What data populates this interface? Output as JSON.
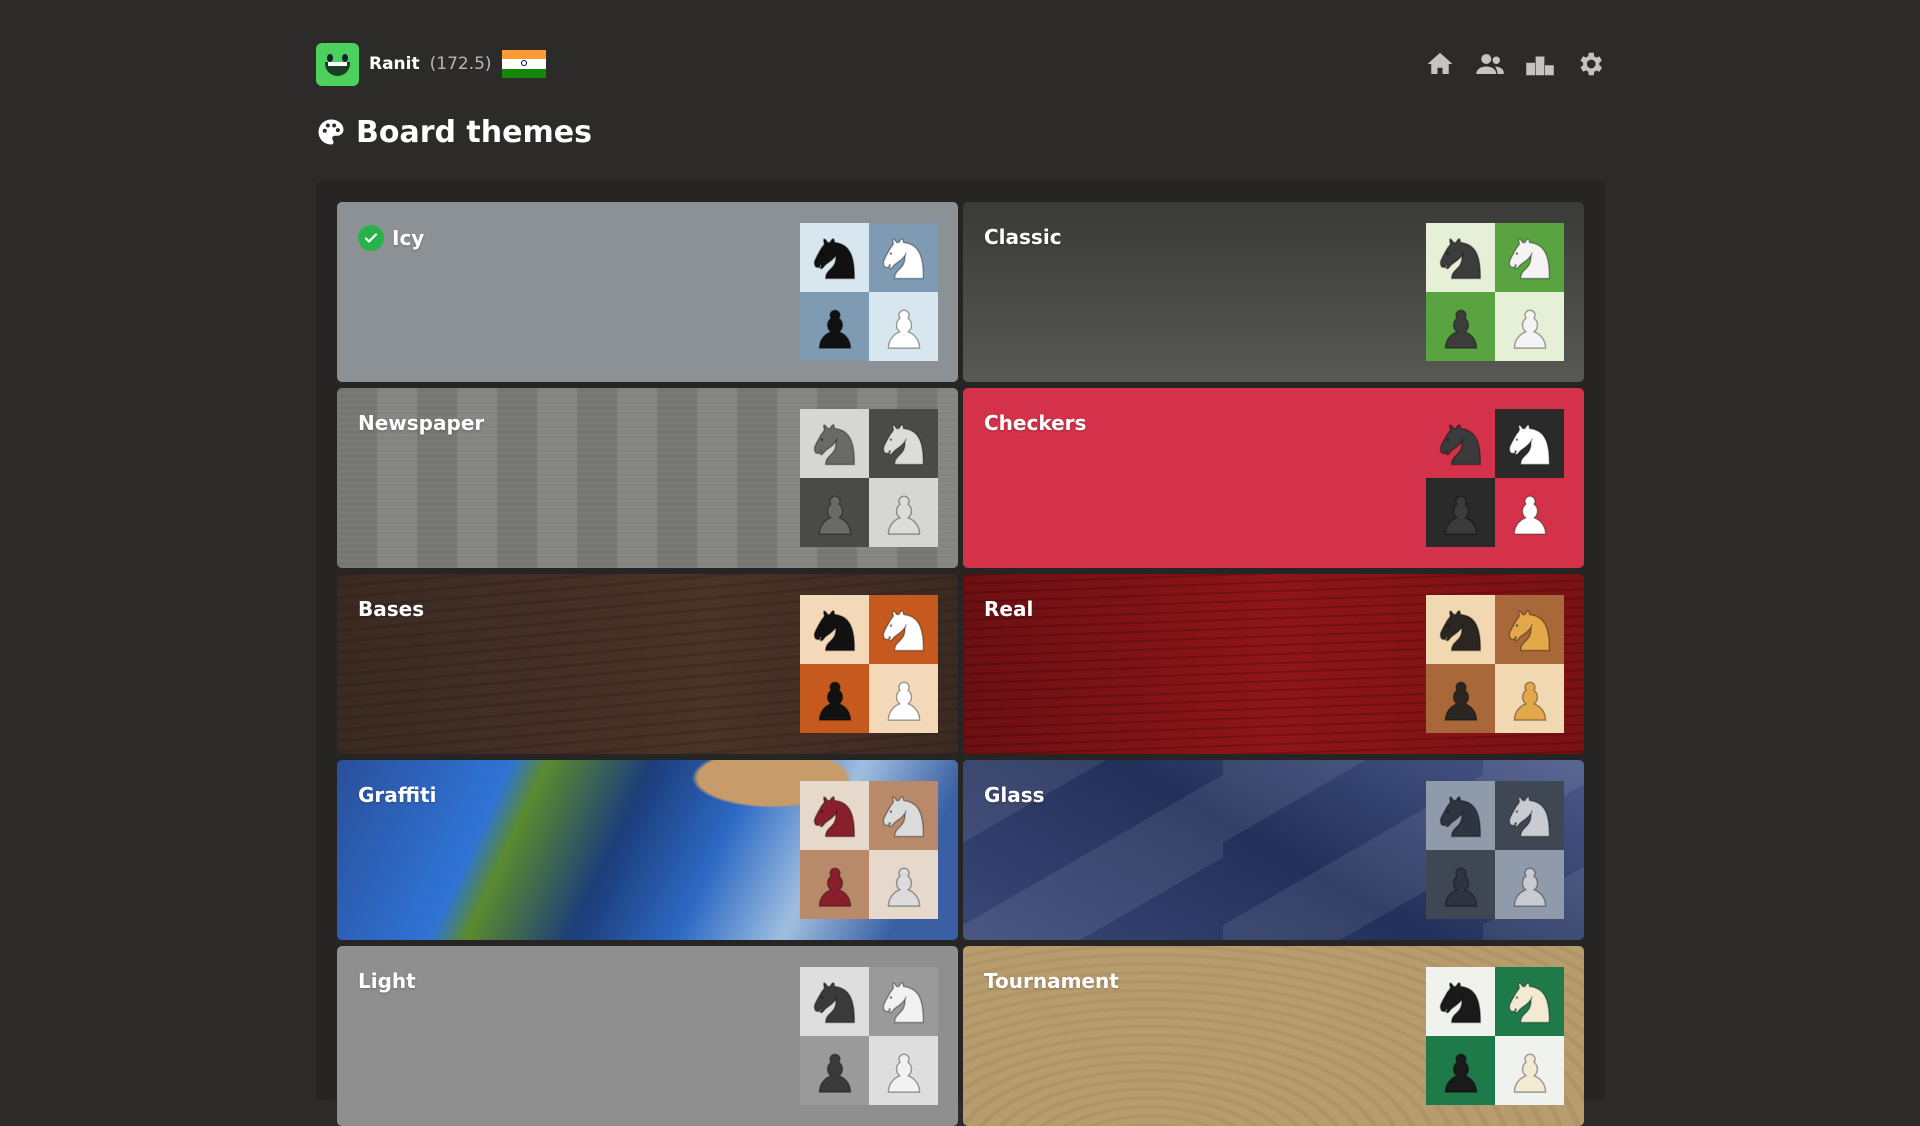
{
  "user": {
    "name": "Ranit",
    "rating": "(172.5)",
    "country": "India"
  },
  "nav": {
    "icons": [
      "home-icon",
      "friends-icon",
      "leaderboard-icon",
      "settings-icon"
    ]
  },
  "page": {
    "title": "Board themes",
    "title_icon": "palette-icon"
  },
  "themes": [
    {
      "name": "Icy",
      "selected": true,
      "light": "#d8e6ef",
      "dark": "#7f9bb4",
      "black_piece": "#111111",
      "white_piece": "#ffffff"
    },
    {
      "name": "Classic",
      "selected": false,
      "light": "#e6f0d6",
      "dark": "#5aa341",
      "black_piece": "#3c3c3c",
      "white_piece": "#f4f4f4"
    },
    {
      "name": "Newspaper",
      "selected": false,
      "light": "#d6d6d2",
      "dark": "#4a4a48",
      "black_piece": "#6a6a68",
      "white_piece": "#dcdcd8"
    },
    {
      "name": "Checkers",
      "selected": false,
      "light": "#d4324a",
      "dark": "#2a2a2a",
      "black_piece": "#3b3b3b",
      "white_piece": "#ffffff"
    },
    {
      "name": "Bases",
      "selected": false,
      "light": "#f3d9b8",
      "dark": "#c65a1e",
      "black_piece": "#111111",
      "white_piece": "#ffffff"
    },
    {
      "name": "Real",
      "selected": false,
      "light": "#f1d8b0",
      "dark": "#a8683a",
      "black_piece": "#2b2622",
      "white_piece": "#e3a84a"
    },
    {
      "name": "Graffiti",
      "selected": false,
      "light": "#e7d8cc",
      "dark": "#b98a6a",
      "black_piece": "#8a1f2c",
      "white_piece": "#dcdcdc"
    },
    {
      "name": "Glass",
      "selected": false,
      "light": "#8f9aab",
      "dark": "#3f4654",
      "black_piece": "#2e3440",
      "white_piece": "#c8ccd2"
    },
    {
      "name": "Light",
      "selected": false,
      "light": "#dedede",
      "dark": "#9a9a9a",
      "black_piece": "#3a3a3a",
      "white_piece": "#f2f2f2"
    },
    {
      "name": "Tournament",
      "selected": false,
      "light": "#f0f2ee",
      "dark": "#1f7a4a",
      "black_piece": "#1a1a1a",
      "white_piece": "#f3ead4"
    }
  ],
  "colors": {
    "background": "#2c2b29",
    "panel": "#262523",
    "accent_green": "#28b34a"
  }
}
